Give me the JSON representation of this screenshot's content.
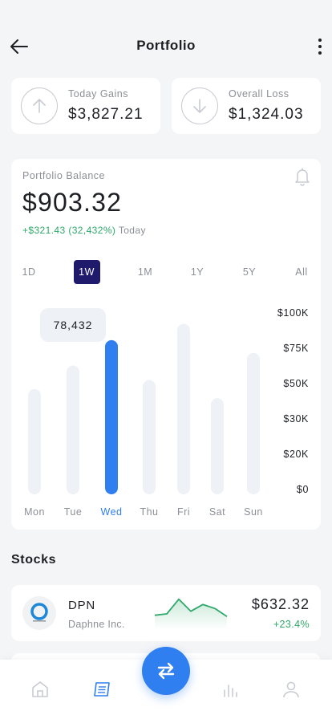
{
  "header": {
    "title": "Portfolio"
  },
  "stats": {
    "gains": {
      "label": "Today Gains",
      "value": "$3,827.21"
    },
    "loss": {
      "label": "Overall Loss",
      "value": "$1,324.03"
    }
  },
  "balance": {
    "label": "Portfolio Balance",
    "value": "$903.32",
    "change": "+$321.43 (32,432%)",
    "change_period": "Today"
  },
  "ranges": [
    {
      "label": "1D",
      "active": false
    },
    {
      "label": "1W",
      "active": true
    },
    {
      "label": "1M",
      "active": false
    },
    {
      "label": "1Y",
      "active": false
    },
    {
      "label": "5Y",
      "active": false
    },
    {
      "label": "All",
      "active": false
    }
  ],
  "colors": {
    "accent": "#2f7ff0",
    "active_tab": "#1f1a6b",
    "positive": "#2fa86a",
    "bar_inactive": "#eef1f6",
    "muted": "#8b8f96"
  },
  "chart_data": {
    "type": "bar",
    "categories": [
      "Mon",
      "Tue",
      "Wed",
      "Thu",
      "Fri",
      "Sat",
      "Sun"
    ],
    "values": [
      58000,
      71000,
      85000,
      63000,
      94000,
      53000,
      78000
    ],
    "highlight_index": 2,
    "tooltip": "78,432",
    "y_ticks": [
      "$0",
      "$20K",
      "$30K",
      "$50K",
      "$75K",
      "$100K"
    ],
    "ylim": [
      0,
      100000
    ],
    "grid": false
  },
  "stocks": {
    "title": "Stocks",
    "items": [
      {
        "ticker": "DPN",
        "name": "Daphne Inc.",
        "price": "$632.32",
        "change": "+23.4%",
        "logo_icon": "ring-logo-icon",
        "spark": [
          10,
          12,
          34,
          16,
          26,
          20,
          8
        ]
      }
    ]
  },
  "nav": {
    "items": [
      {
        "icon": "home-icon",
        "active": false
      },
      {
        "icon": "news-icon",
        "active": true
      },
      {
        "icon": "swap-icon",
        "active": false
      },
      {
        "icon": "stats-icon",
        "active": false
      },
      {
        "icon": "profile-icon",
        "active": false
      }
    ]
  }
}
